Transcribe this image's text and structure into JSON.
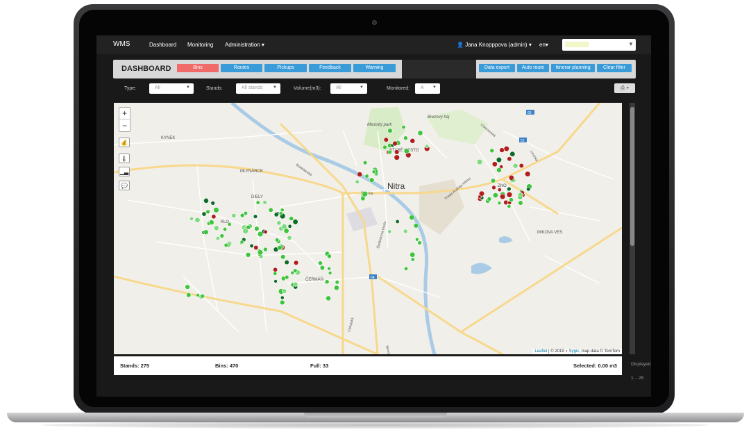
{
  "navbar": {
    "brand": "WMS",
    "items": [
      "Dashboard",
      "Monitoring",
      "Administration"
    ],
    "user": "Jana Knopppova (admin)",
    "language": "en",
    "select_value": ""
  },
  "toolbar": {
    "title": "DASHBOARD",
    "tabs": [
      {
        "label": "Bins",
        "color": "#f06a6a"
      },
      {
        "label": "Routes",
        "color": "#3a9bd9"
      },
      {
        "label": "Pickups",
        "color": "#3a9bd9"
      },
      {
        "label": "Feedback",
        "color": "#3a9bd9"
      },
      {
        "label": "Warning",
        "color": "#3a9bd9"
      }
    ],
    "actions": [
      "Data export",
      "Auto route",
      "Itinerar planning",
      "Clear filter"
    ]
  },
  "filters": {
    "type_label": "Type:",
    "type_value": "All",
    "stands_label": "Stands:",
    "stands_value": "All stands",
    "volume_label": "Volume(m3):",
    "volume_value": "All",
    "monitored_label": "Monitored:",
    "monitored_value": "A"
  },
  "map": {
    "places": [
      "KYNEK",
      "MLYNÁRCE",
      "DIELY",
      "KLO",
      "ČERMÁŇ",
      "STARÉ MESTO",
      "ZNO",
      "MIKOVA VES",
      "Mestský park",
      "Brezový háj",
      "Nitra",
      "Bratislavská",
      "Štúrova",
      "Štefánikova trieda",
      "Cabajská",
      "Novozámocká",
      "Levická",
      "Trieda Andreja Hlinku",
      "Chrenovská"
    ],
    "road_shields": [
      "65",
      "51",
      "64"
    ],
    "attribution": {
      "leaflet": "Leaflet",
      "text": "| © 2019",
      "sygic": "Sygic",
      "rest": ", map data © TomTom"
    },
    "tools": [
      "money-bag-icon",
      "thermometer-icon",
      "signal-icon",
      "comment-icon"
    ]
  },
  "status": {
    "stands": "Stands: 275",
    "bins": "Bins: 470",
    "full": "Full: 33",
    "selected": "Selected: 0.00 m3"
  },
  "side": {
    "displayed": "Displayed",
    "range": "1. - 25"
  },
  "colors": {
    "marker_green": "#3ec43e",
    "marker_light": "#7fd97f",
    "marker_dark": "#0e6b2a",
    "marker_red": "#b01e1e"
  }
}
